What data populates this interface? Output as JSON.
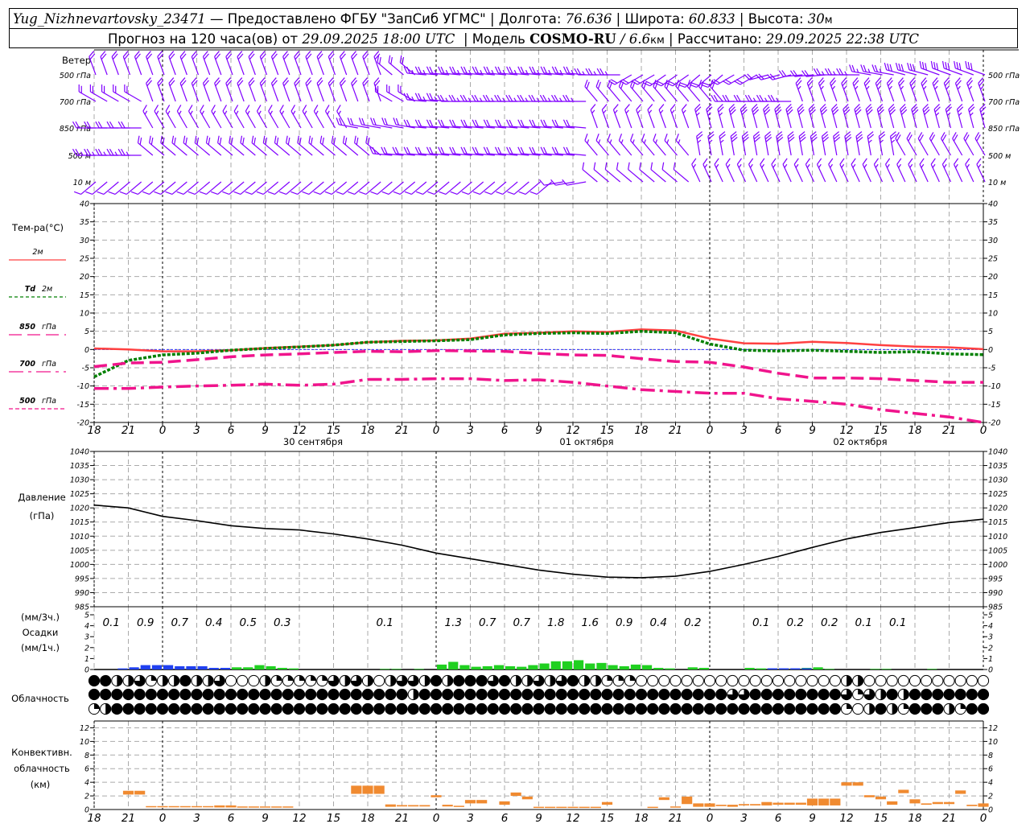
{
  "header": {
    "station": "Yug_Nizhnevartovsky_23471",
    "provided": "— Предоставлено ФГБУ \"ЗапСиб УГМС\"",
    "longitude_label": "Долгота:",
    "longitude": "76.636",
    "latitude_label": "Широта:",
    "latitude": "60.833",
    "altitude_label": "Высота:",
    "altitude": "30",
    "altitude_unit": "м",
    "forecast_prefix": "Прогноз на 120 часа(ов) от",
    "forecast_time": "29.09.2025 18:00 UTC",
    "model_label": "Модель",
    "model": "COSMO-RU",
    "resolution": "/ 6.6",
    "resolution_unit": "км",
    "calc_label": "Рассчитано:",
    "calc_time": "29.09.2025 22:38 UTC",
    "separator": "|"
  },
  "time_axis": {
    "step_hours": 3,
    "hour_labels": [
      "18",
      "21",
      "0",
      "3",
      "6",
      "9",
      "12",
      "15",
      "18",
      "21",
      "0",
      "3",
      "6",
      "9",
      "12",
      "15",
      "18",
      "21",
      "0",
      "3",
      "6",
      "9",
      "12",
      "15",
      "18",
      "21",
      "0"
    ],
    "dates": [
      "30 сентября",
      "01 октября",
      "02 октября"
    ]
  },
  "chart_data": [
    {
      "type": "wind-barbs",
      "title": "Ветер",
      "units": "m/s",
      "color": "#8000ff",
      "levels": [
        {
          "label": "500 гПа",
          "dir": [
            340,
            340,
            340,
            340,
            340,
            340,
            340,
            340,
            340,
            310,
            275,
            275,
            275,
            275,
            275,
            270,
            240,
            235,
            230,
            240,
            255,
            265,
            270,
            280,
            285,
            290,
            290
          ],
          "speed": [
            10,
            10,
            10,
            10,
            10,
            10,
            10,
            10,
            10,
            10,
            12,
            12,
            12,
            12,
            12,
            12,
            10,
            10,
            10,
            10,
            10,
            10,
            12,
            12,
            15,
            15,
            15
          ]
        },
        {
          "label": "700 гПа",
          "dir": [
            300,
            300,
            340,
            340,
            340,
            340,
            340,
            340,
            340,
            300,
            275,
            270,
            270,
            270,
            270,
            320,
            320,
            320,
            320,
            270,
            270,
            340,
            340,
            340,
            340,
            340,
            340
          ],
          "speed": [
            10,
            10,
            10,
            10,
            10,
            10,
            10,
            10,
            10,
            10,
            12,
            12,
            12,
            12,
            12,
            10,
            10,
            10,
            10,
            10,
            12,
            12,
            12,
            12,
            12,
            12,
            12
          ]
        },
        {
          "label": "850 гПа",
          "dir": [
            270,
            270,
            330,
            330,
            330,
            330,
            330,
            330,
            280,
            280,
            275,
            275,
            275,
            275,
            275,
            340,
            340,
            340,
            345,
            345,
            345,
            345,
            345,
            345,
            345,
            345,
            345
          ],
          "speed": [
            10,
            10,
            8,
            8,
            8,
            8,
            8,
            8,
            10,
            10,
            10,
            10,
            10,
            10,
            10,
            8,
            8,
            8,
            12,
            15,
            15,
            15,
            15,
            15,
            15,
            12,
            12
          ]
        },
        {
          "label": "500 м",
          "dir": [
            270,
            270,
            310,
            310,
            310,
            310,
            310,
            310,
            310,
            275,
            275,
            275,
            275,
            275,
            275,
            320,
            320,
            320,
            350,
            350,
            350,
            350,
            350,
            350,
            330,
            330,
            330
          ],
          "speed": [
            12,
            12,
            10,
            10,
            10,
            10,
            10,
            10,
            10,
            10,
            10,
            10,
            10,
            10,
            10,
            8,
            8,
            8,
            12,
            15,
            15,
            15,
            15,
            12,
            10,
            10,
            10
          ]
        },
        {
          "label": "10 м",
          "dir": [
            230,
            230,
            230,
            230,
            230,
            230,
            230,
            230,
            230,
            230,
            230,
            230,
            230,
            230,
            260,
            310,
            310,
            310,
            335,
            335,
            335,
            335,
            335,
            335,
            335,
            335,
            335
          ],
          "speed": [
            5,
            5,
            5,
            5,
            5,
            5,
            5,
            5,
            5,
            5,
            5,
            5,
            5,
            5,
            5,
            5,
            5,
            5,
            7,
            7,
            7,
            7,
            7,
            7,
            7,
            7,
            7
          ]
        }
      ]
    },
    {
      "type": "line",
      "title": "Тем-ра(°С)",
      "ylim": [
        -20,
        40
      ],
      "yticks": [
        "40",
        "35",
        "30",
        "25",
        "20",
        "15",
        "10",
        "5",
        "0",
        "-5",
        "-10",
        "-15",
        "-20"
      ],
      "grid": true,
      "series": [
        {
          "name": "2м",
          "color": "#ff4040",
          "style": "solid",
          "values": [
            0.3,
            0,
            -0.5,
            -0.5,
            -0.2,
            0.4,
            0.8,
            1.2,
            2,
            2.4,
            2.5,
            3,
            4.3,
            4.6,
            5,
            4.8,
            5.5,
            5.2,
            3,
            1.7,
            1.6,
            2.1,
            1.8,
            1.2,
            0.8,
            0.6,
            0.1
          ]
        },
        {
          "name": "Td",
          "name_suffix": "2м",
          "color": "#008000",
          "style": "dotted",
          "values": [
            -7.5,
            -3,
            -1.5,
            -1,
            -0.2,
            0.3,
            0.7,
            1.2,
            2,
            2.2,
            2.4,
            2.7,
            4,
            4.4,
            4.6,
            4.4,
            5,
            4.6,
            1.5,
            -0.2,
            -0.4,
            -0.2,
            -0.5,
            -0.8,
            -0.6,
            -1.2,
            -1.4
          ]
        },
        {
          "name": "850",
          "name_suffix": "гПа",
          "color": "#f0148c",
          "style": "dashed",
          "values": [
            -4.7,
            -3.7,
            -3.5,
            -2.8,
            -2,
            -1.5,
            -1.2,
            -0.8,
            -0.5,
            -0.6,
            -0.3,
            -0.4,
            -0.5,
            -1.1,
            -1.5,
            -1.6,
            -2.5,
            -3.3,
            -3.5,
            -4.8,
            -6.5,
            -7.8,
            -7.8,
            -8,
            -8.5,
            -9,
            -9
          ]
        },
        {
          "name": "700",
          "name_suffix": "гПа",
          "color": "#f0148c",
          "style": "dash-dot",
          "values": [
            -10.7,
            -10.7,
            -10.3,
            -10,
            -9.8,
            -9.5,
            -9.8,
            -9.5,
            -8.2,
            -8.2,
            -8,
            -8,
            -8.5,
            -8.3,
            -9,
            -10,
            -11,
            -11.5,
            -12,
            -12,
            -13.5,
            -14.2,
            -15,
            -16.5,
            -17.5,
            -18.5,
            -20
          ]
        },
        {
          "name": "500",
          "name_suffix": "гПа",
          "color": "#f0148c",
          "style": "short-dash",
          "values": []
        }
      ],
      "zero_line_color": "#3030ff"
    },
    {
      "type": "line",
      "title": "Давление",
      "unit_label": "(гПа)",
      "ylim": [
        985,
        1040
      ],
      "yticks": [
        "1040",
        "1035",
        "1030",
        "1025",
        "1020",
        "1015",
        "1010",
        "1005",
        "1000",
        "995",
        "990",
        "985"
      ],
      "grid": true,
      "color": "#000000",
      "values": [
        1021,
        1020,
        1017,
        1015.5,
        1013.7,
        1012.7,
        1012.2,
        1010.8,
        1009,
        1006.8,
        1004,
        1002,
        1000,
        998,
        996.5,
        995.5,
        995.3,
        995.8,
        997.5,
        1000,
        1002.8,
        1006,
        1009,
        1011.3,
        1013,
        1014.8,
        1016
      ]
    },
    {
      "type": "bar",
      "title": "Осадки",
      "unit_3h": "(мм/3ч.)",
      "unit_1h": "(мм/1ч.)",
      "ylim": [
        0,
        5
      ],
      "yticks": [
        "5",
        "4",
        "3",
        "2",
        "1",
        "0"
      ],
      "colors": {
        "snow": "#2040f0",
        "rain": "#20d020"
      },
      "totals_3h": [
        "0.1",
        "0.9",
        "0.7",
        "0.4",
        "0.5",
        "0.3",
        "",
        "",
        "0.1",
        "",
        "1.3",
        "0.7",
        "0.7",
        "1.8",
        "1.6",
        "0.9",
        "0.4",
        "0.2",
        "",
        "0.1",
        "0.2",
        "0.2",
        "0.1",
        "0.1",
        "",
        ""
      ],
      "hourly": [
        0,
        0,
        0.1,
        0.2,
        0.4,
        0.4,
        0.4,
        0.3,
        0.3,
        0.3,
        0.15,
        0.15,
        0.2,
        0.2,
        0.4,
        0.3,
        0.15,
        0.1,
        0,
        0,
        0,
        0,
        0,
        0,
        0,
        0.05,
        0.05,
        0,
        0.05,
        0,
        0.45,
        0.7,
        0.4,
        0.25,
        0.3,
        0.4,
        0.3,
        0.25,
        0.4,
        0.55,
        0.75,
        0.75,
        0.85,
        0.55,
        0.6,
        0.4,
        0.3,
        0.45,
        0.4,
        0.15,
        0.1,
        0,
        0.2,
        0.15,
        0,
        0,
        0,
        0.15,
        0.1,
        0.1,
        0.1,
        0.1,
        0.15,
        0.2,
        0.05,
        0,
        0,
        0,
        0.05,
        0.05,
        0,
        0,
        0,
        0.05,
        0,
        0,
        0,
        0
      ],
      "hourly_type": "rrssssssssssrrrrrrrrrrrrrrrrrrrrrrrrrrrrrrrrrrrrrrrrrrrrrrrmmmmrrrrrrrrrsrrrrr"
    },
    {
      "type": "symbols",
      "title": "Облачность",
      "legend": "fraction of sky covered, quarters (0=clear, 4=overcast)",
      "rows": [
        "4422312242230002111113232023324244434223234221110000000000000000002200000000000",
        "4444444444444444444444444444244444444444444444444444444433444444443132424444444",
        "1244444444444444444444444444444444444444444444444444444444444444441024214442144"
      ]
    },
    {
      "type": "range-bar",
      "title": "Конвективн. облачность",
      "unit_label": "(км)",
      "ylim": [
        0,
        13
      ],
      "yticks": [
        "12",
        "10",
        "8",
        "6",
        "4",
        "2",
        "0"
      ],
      "color": "#f08a30",
      "bars": [
        {
          "h": 3,
          "base": 2.2,
          "top": 2.75
        },
        {
          "h": 4,
          "base": 2.2,
          "top": 2.75
        },
        {
          "h": 5,
          "base": 0.35,
          "top": 0.5
        },
        {
          "h": 6,
          "base": 0.35,
          "top": 0.5
        },
        {
          "h": 7,
          "base": 0.35,
          "top": 0.5
        },
        {
          "h": 8,
          "base": 0.35,
          "top": 0.5
        },
        {
          "h": 9,
          "base": 0.35,
          "top": 0.5
        },
        {
          "h": 10,
          "base": 0.35,
          "top": 0.5
        },
        {
          "h": 11,
          "base": 0.3,
          "top": 0.6
        },
        {
          "h": 12,
          "base": 0.3,
          "top": 0.6
        },
        {
          "h": 13,
          "base": 0.3,
          "top": 0.45
        },
        {
          "h": 14,
          "base": 0.3,
          "top": 0.45
        },
        {
          "h": 15,
          "base": 0.3,
          "top": 0.45
        },
        {
          "h": 16,
          "base": 0.3,
          "top": 0.45
        },
        {
          "h": 17,
          "base": 0.3,
          "top": 0.45
        },
        {
          "h": 23,
          "base": 2.3,
          "top": 3.5
        },
        {
          "h": 24,
          "base": 2.3,
          "top": 3.5
        },
        {
          "h": 25,
          "base": 2.3,
          "top": 3.5
        },
        {
          "h": 26,
          "base": 0.4,
          "top": 0.75
        },
        {
          "h": 27,
          "base": 0.45,
          "top": 0.65
        },
        {
          "h": 28,
          "base": 0.45,
          "top": 0.65
        },
        {
          "h": 29,
          "base": 0.45,
          "top": 0.65
        },
        {
          "h": 30,
          "base": 1.8,
          "top": 2.1
        },
        {
          "h": 31,
          "base": 0.45,
          "top": 0.7
        },
        {
          "h": 32,
          "base": 0.45,
          "top": 0.55
        },
        {
          "h": 33,
          "base": 0.9,
          "top": 1.4
        },
        {
          "h": 34,
          "base": 0.9,
          "top": 1.4
        },
        {
          "h": 36,
          "base": 0.7,
          "top": 1.2
        },
        {
          "h": 37,
          "base": 2.0,
          "top": 2.5
        },
        {
          "h": 38,
          "base": 1.5,
          "top": 1.9
        },
        {
          "h": 39,
          "base": 0.3,
          "top": 0.4
        },
        {
          "h": 40,
          "base": 0.3,
          "top": 0.4
        },
        {
          "h": 41,
          "base": 0.3,
          "top": 0.4
        },
        {
          "h": 42,
          "base": 0.3,
          "top": 0.4
        },
        {
          "h": 43,
          "base": 0.3,
          "top": 0.4
        },
        {
          "h": 44,
          "base": 0.3,
          "top": 0.4
        },
        {
          "h": 45,
          "base": 0.7,
          "top": 1.1
        },
        {
          "h": 49,
          "base": 0.3,
          "top": 0.4
        },
        {
          "h": 50,
          "base": 1.4,
          "top": 1.8
        },
        {
          "h": 51,
          "base": 0.35,
          "top": 0.45
        },
        {
          "h": 52,
          "base": 0.8,
          "top": 1.9
        },
        {
          "h": 53,
          "base": 0.4,
          "top": 0.9
        },
        {
          "h": 54,
          "base": 0.4,
          "top": 0.9
        },
        {
          "h": 55,
          "base": 0.5,
          "top": 0.7
        },
        {
          "h": 56,
          "base": 0.4,
          "top": 0.7
        },
        {
          "h": 57,
          "base": 0.6,
          "top": 0.8
        },
        {
          "h": 58,
          "base": 0.6,
          "top": 0.8
        },
        {
          "h": 59,
          "base": 0.6,
          "top": 1.1
        },
        {
          "h": 60,
          "base": 0.7,
          "top": 1.0
        },
        {
          "h": 61,
          "base": 0.7,
          "top": 1.0
        },
        {
          "h": 62,
          "base": 0.7,
          "top": 1.0
        },
        {
          "h": 63,
          "base": 0.6,
          "top": 1.6
        },
        {
          "h": 64,
          "base": 0.6,
          "top": 1.6
        },
        {
          "h": 65,
          "base": 0.6,
          "top": 1.6
        },
        {
          "h": 66,
          "base": 3.5,
          "top": 4.0
        },
        {
          "h": 67,
          "base": 3.5,
          "top": 4.0
        },
        {
          "h": 68,
          "base": 1.8,
          "top": 2.1
        },
        {
          "h": 69,
          "base": 1.5,
          "top": 1.9
        },
        {
          "h": 70,
          "base": 0.7,
          "top": 1.2
        },
        {
          "h": 71,
          "base": 2.4,
          "top": 2.9
        },
        {
          "h": 72,
          "base": 0.9,
          "top": 1.5
        },
        {
          "h": 73,
          "base": 0.7,
          "top": 0.9
        },
        {
          "h": 74,
          "base": 0.8,
          "top": 1.1
        },
        {
          "h": 75,
          "base": 0.8,
          "top": 1.1
        },
        {
          "h": 76,
          "base": 2.3,
          "top": 2.8
        },
        {
          "h": 77,
          "base": 0.5,
          "top": 0.7
        },
        {
          "h": 78,
          "base": 0.4,
          "top": 0.9
        }
      ]
    }
  ]
}
